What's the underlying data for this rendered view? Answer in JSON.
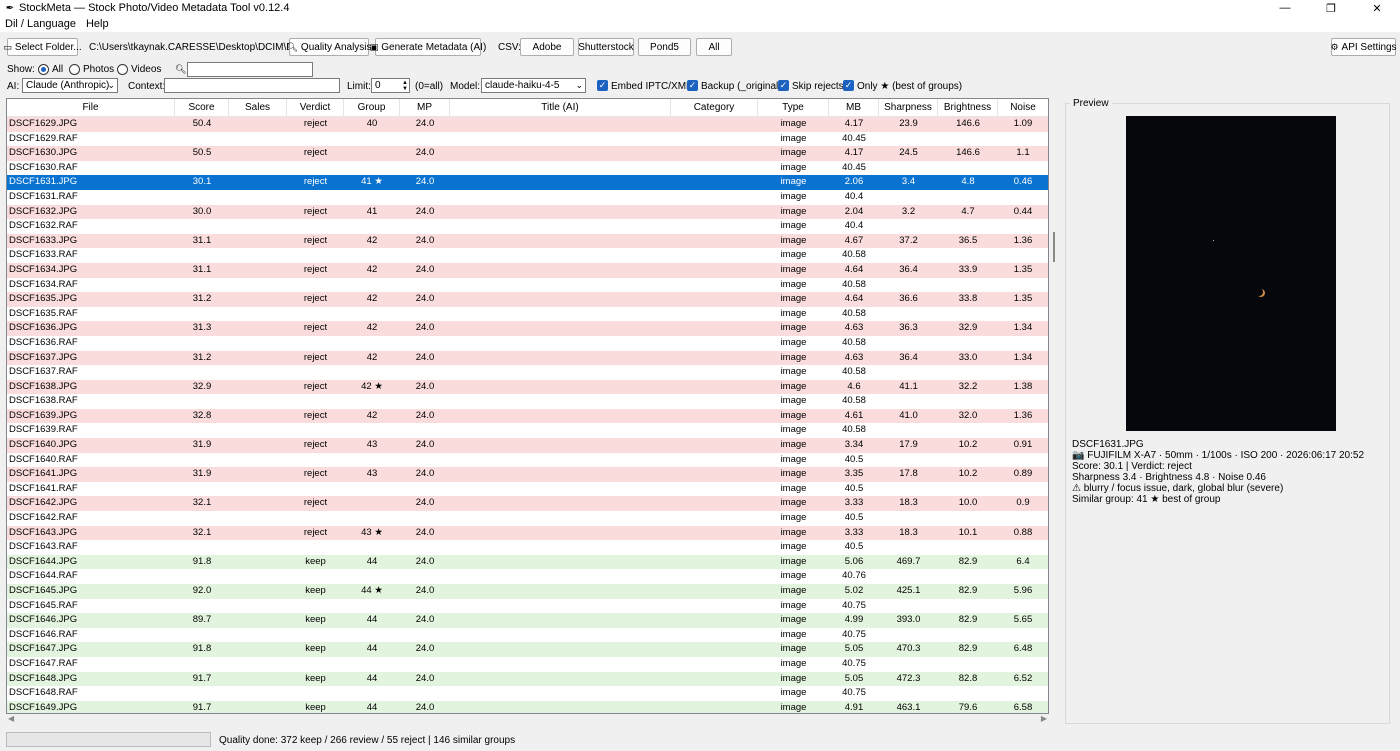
{
  "window": {
    "title": "StockMeta — Stock Photo/Video Metadata Tool  v0.12.4",
    "min": "—",
    "max": "❐",
    "close": "✕"
  },
  "menu": [
    "Dil / Language",
    "Help"
  ],
  "toolbar": {
    "select_folder": "Select Folder...",
    "folder_path": "C:\\Users\\tkaynak.CARESSE\\Desktop\\DCIM\\DCIM",
    "quality_analysis": "Quality Analysis",
    "generate_metadata": "Generate Metadata (AI)",
    "csv_label": "CSV:",
    "csv_buttons": [
      "Adobe",
      "Shutterstock",
      "Pond5",
      "All"
    ],
    "api_settings": "API Settings"
  },
  "filter": {
    "show_label": "Show:",
    "options": [
      "All",
      "Photos",
      "Videos"
    ],
    "selected": "All",
    "search_value": ""
  },
  "ai": {
    "ai_label": "AI:",
    "provider": "Claude (Anthropic)",
    "context_label": "Context:",
    "context_value": "",
    "limit_label": "Limit:",
    "limit_value": "0",
    "limit_hint": "(0=all)",
    "model_label": "Model:",
    "model_value": "claude-haiku-4-5",
    "checks": [
      {
        "label": "Embed IPTC/XMP",
        "checked": true
      },
      {
        "label": "Backup (_original)",
        "checked": true
      },
      {
        "label": "Skip rejects",
        "checked": true
      },
      {
        "label": "Only ★ (best of groups)",
        "checked": true
      }
    ]
  },
  "table": {
    "columns": [
      "File",
      "Score",
      "Sales",
      "Verdict",
      "Group",
      "MP",
      "Title (AI)",
      "Category",
      "Type",
      "MB",
      "Sharpness",
      "Brightness",
      "Noise"
    ],
    "selected_file": "DSCF1631.JPG",
    "rows": [
      [
        "DSCF1629.JPG",
        "50.4",
        "",
        "reject",
        "40",
        "24.0",
        "",
        "",
        "image",
        "4.17",
        "23.9",
        "146.6",
        "1.09"
      ],
      [
        "DSCF1629.RAF",
        "",
        "",
        "",
        "",
        "",
        "",
        "",
        "image",
        "40.45",
        "",
        "",
        ""
      ],
      [
        "DSCF1630.JPG",
        "50.5",
        "",
        "reject",
        "",
        "24.0",
        "",
        "",
        "image",
        "4.17",
        "24.5",
        "146.6",
        "1.1"
      ],
      [
        "DSCF1630.RAF",
        "",
        "",
        "",
        "",
        "",
        "",
        "",
        "image",
        "40.45",
        "",
        "",
        ""
      ],
      [
        "DSCF1631.JPG",
        "30.1",
        "",
        "reject",
        "41 ★",
        "24.0",
        "",
        "",
        "image",
        "2.06",
        "3.4",
        "4.8",
        "0.46"
      ],
      [
        "DSCF1631.RAF",
        "",
        "",
        "",
        "",
        "",
        "",
        "",
        "image",
        "40.4",
        "",
        "",
        ""
      ],
      [
        "DSCF1632.JPG",
        "30.0",
        "",
        "reject",
        "41",
        "24.0",
        "",
        "",
        "image",
        "2.04",
        "3.2",
        "4.7",
        "0.44"
      ],
      [
        "DSCF1632.RAF",
        "",
        "",
        "",
        "",
        "",
        "",
        "",
        "image",
        "40.4",
        "",
        "",
        ""
      ],
      [
        "DSCF1633.JPG",
        "31.1",
        "",
        "reject",
        "42",
        "24.0",
        "",
        "",
        "image",
        "4.67",
        "37.2",
        "36.5",
        "1.36"
      ],
      [
        "DSCF1633.RAF",
        "",
        "",
        "",
        "",
        "",
        "",
        "",
        "image",
        "40.58",
        "",
        "",
        ""
      ],
      [
        "DSCF1634.JPG",
        "31.1",
        "",
        "reject",
        "42",
        "24.0",
        "",
        "",
        "image",
        "4.64",
        "36.4",
        "33.9",
        "1.35"
      ],
      [
        "DSCF1634.RAF",
        "",
        "",
        "",
        "",
        "",
        "",
        "",
        "image",
        "40.58",
        "",
        "",
        ""
      ],
      [
        "DSCF1635.JPG",
        "31.2",
        "",
        "reject",
        "42",
        "24.0",
        "",
        "",
        "image",
        "4.64",
        "36.6",
        "33.8",
        "1.35"
      ],
      [
        "DSCF1635.RAF",
        "",
        "",
        "",
        "",
        "",
        "",
        "",
        "image",
        "40.58",
        "",
        "",
        ""
      ],
      [
        "DSCF1636.JPG",
        "31.3",
        "",
        "reject",
        "42",
        "24.0",
        "",
        "",
        "image",
        "4.63",
        "36.3",
        "32.9",
        "1.34"
      ],
      [
        "DSCF1636.RAF",
        "",
        "",
        "",
        "",
        "",
        "",
        "",
        "image",
        "40.58",
        "",
        "",
        ""
      ],
      [
        "DSCF1637.JPG",
        "31.2",
        "",
        "reject",
        "42",
        "24.0",
        "",
        "",
        "image",
        "4.63",
        "36.4",
        "33.0",
        "1.34"
      ],
      [
        "DSCF1637.RAF",
        "",
        "",
        "",
        "",
        "",
        "",
        "",
        "image",
        "40.58",
        "",
        "",
        ""
      ],
      [
        "DSCF1638.JPG",
        "32.9",
        "",
        "reject",
        "42 ★",
        "24.0",
        "",
        "",
        "image",
        "4.6",
        "41.1",
        "32.2",
        "1.38"
      ],
      [
        "DSCF1638.RAF",
        "",
        "",
        "",
        "",
        "",
        "",
        "",
        "image",
        "40.58",
        "",
        "",
        ""
      ],
      [
        "DSCF1639.JPG",
        "32.8",
        "",
        "reject",
        "42",
        "24.0",
        "",
        "",
        "image",
        "4.61",
        "41.0",
        "32.0",
        "1.36"
      ],
      [
        "DSCF1639.RAF",
        "",
        "",
        "",
        "",
        "",
        "",
        "",
        "image",
        "40.58",
        "",
        "",
        ""
      ],
      [
        "DSCF1640.JPG",
        "31.9",
        "",
        "reject",
        "43",
        "24.0",
        "",
        "",
        "image",
        "3.34",
        "17.9",
        "10.2",
        "0.91"
      ],
      [
        "DSCF1640.RAF",
        "",
        "",
        "",
        "",
        "",
        "",
        "",
        "image",
        "40.5",
        "",
        "",
        ""
      ],
      [
        "DSCF1641.JPG",
        "31.9",
        "",
        "reject",
        "43",
        "24.0",
        "",
        "",
        "image",
        "3.35",
        "17.8",
        "10.2",
        "0.89"
      ],
      [
        "DSCF1641.RAF",
        "",
        "",
        "",
        "",
        "",
        "",
        "",
        "image",
        "40.5",
        "",
        "",
        ""
      ],
      [
        "DSCF1642.JPG",
        "32.1",
        "",
        "reject",
        "",
        "24.0",
        "",
        "",
        "image",
        "3.33",
        "18.3",
        "10.0",
        "0.9"
      ],
      [
        "DSCF1642.RAF",
        "",
        "",
        "",
        "",
        "",
        "",
        "",
        "image",
        "40.5",
        "",
        "",
        ""
      ],
      [
        "DSCF1643.JPG",
        "32.1",
        "",
        "reject",
        "43 ★",
        "24.0",
        "",
        "",
        "image",
        "3.33",
        "18.3",
        "10.1",
        "0.88"
      ],
      [
        "DSCF1643.RAF",
        "",
        "",
        "",
        "",
        "",
        "",
        "",
        "image",
        "40.5",
        "",
        "",
        ""
      ],
      [
        "DSCF1644.JPG",
        "91.8",
        "",
        "keep",
        "44",
        "24.0",
        "",
        "",
        "image",
        "5.06",
        "469.7",
        "82.9",
        "6.4"
      ],
      [
        "DSCF1644.RAF",
        "",
        "",
        "",
        "",
        "",
        "",
        "",
        "image",
        "40.76",
        "",
        "",
        ""
      ],
      [
        "DSCF1645.JPG",
        "92.0",
        "",
        "keep",
        "44 ★",
        "24.0",
        "",
        "",
        "image",
        "5.02",
        "425.1",
        "82.9",
        "5.96"
      ],
      [
        "DSCF1645.RAF",
        "",
        "",
        "",
        "",
        "",
        "",
        "",
        "image",
        "40.75",
        "",
        "",
        ""
      ],
      [
        "DSCF1646.JPG",
        "89.7",
        "",
        "keep",
        "44",
        "24.0",
        "",
        "",
        "image",
        "4.99",
        "393.0",
        "82.9",
        "5.65"
      ],
      [
        "DSCF1646.RAF",
        "",
        "",
        "",
        "",
        "",
        "",
        "",
        "image",
        "40.75",
        "",
        "",
        ""
      ],
      [
        "DSCF1647.JPG",
        "91.8",
        "",
        "keep",
        "44",
        "24.0",
        "",
        "",
        "image",
        "5.05",
        "470.3",
        "82.9",
        "6.48"
      ],
      [
        "DSCF1647.RAF",
        "",
        "",
        "",
        "",
        "",
        "",
        "",
        "image",
        "40.75",
        "",
        "",
        ""
      ],
      [
        "DSCF1648.JPG",
        "91.7",
        "",
        "keep",
        "44",
        "24.0",
        "",
        "",
        "image",
        "5.05",
        "472.3",
        "82.8",
        "6.52"
      ],
      [
        "DSCF1648.RAF",
        "",
        "",
        "",
        "",
        "",
        "",
        "",
        "image",
        "40.75",
        "",
        "",
        ""
      ],
      [
        "DSCF1649.JPG",
        "91.7",
        "",
        "keep",
        "44",
        "24.0",
        "",
        "",
        "image",
        "4.91",
        "463.1",
        "79.6",
        "6.58"
      ]
    ]
  },
  "preview": {
    "label": "Preview",
    "filename": "DSCF1631.JPG",
    "camera": "📷 FUJIFILM X-A7 · 50mm · 1/100s · ISO 200 · 2026:06:17 20:52",
    "score_line": "Score: 30.1  |  Verdict: reject",
    "metrics_line": "Sharpness 3.4  ·  Brightness 4.8  ·  Noise 0.46",
    "warning_line": "⚠ blurry / focus issue, dark, global blur (severe)",
    "group_line": "Similar group: 41  ★ best of group"
  },
  "status": {
    "text": "Quality done: 372 keep / 266 review / 55 reject | 146 similar groups"
  },
  "colors": {
    "selected": "#0a72d1",
    "reject": "#fadcdc",
    "keep": "#e3f4de"
  }
}
